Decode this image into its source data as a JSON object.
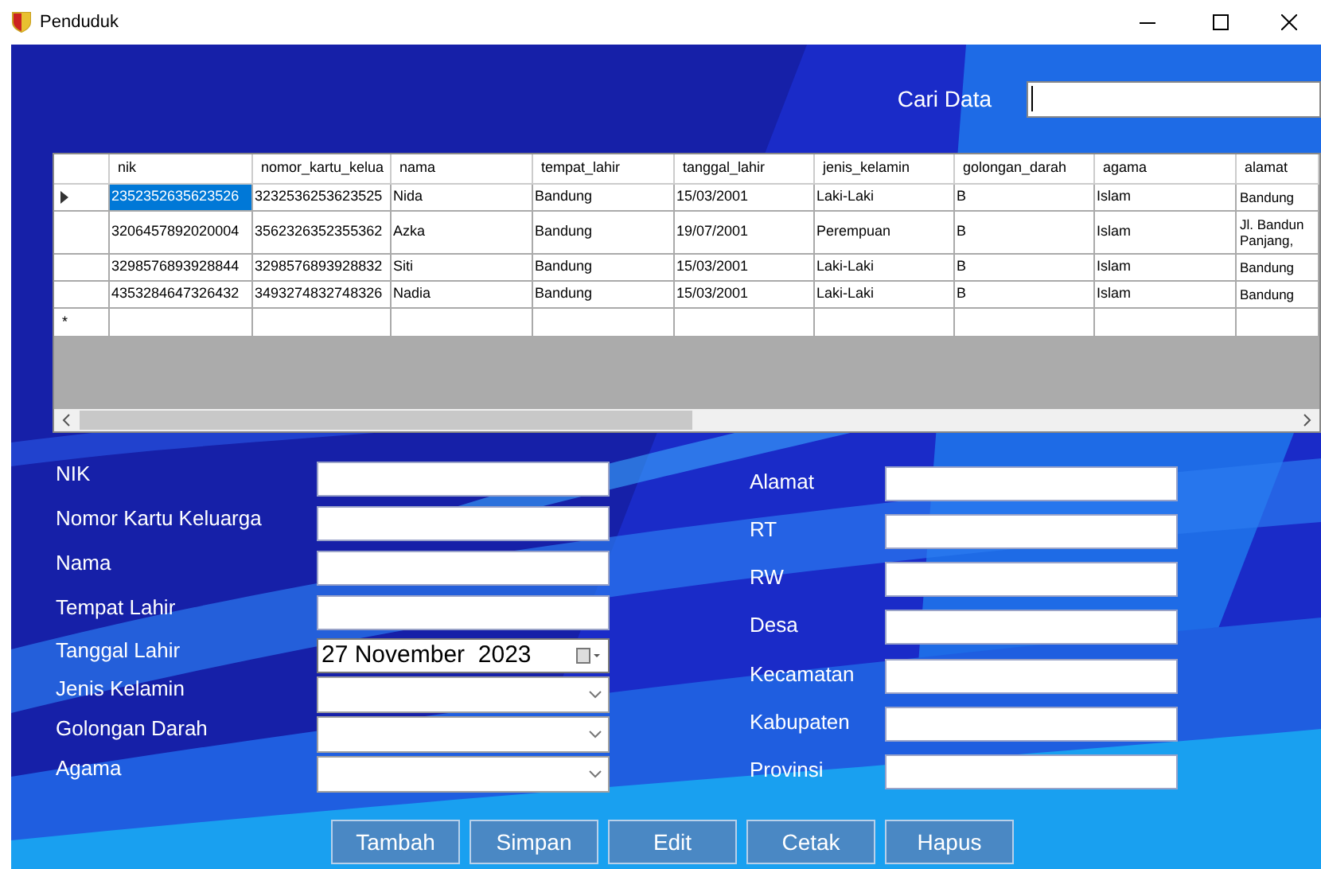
{
  "window": {
    "title": "Penduduk"
  },
  "search": {
    "label": "Cari Data"
  },
  "table": {
    "columns": [
      "nik",
      "nomor_kartu_kelua",
      "nama",
      "tempat_lahir",
      "tanggal_lahir",
      "jenis_kelamin",
      "golongan_darah",
      "agama",
      "alamat"
    ],
    "rows": [
      {
        "selected": true,
        "cells": [
          "2352352635623526",
          "3232536253623525",
          "Nida",
          "Bandung",
          "15/03/2001",
          "Laki-Laki",
          "B",
          "Islam",
          "Bandung"
        ]
      },
      {
        "selected": false,
        "cells": [
          "3206457892020004",
          "3562326352355362",
          "Azka",
          "Bandung",
          "19/07/2001",
          "Perempuan",
          "B",
          "Islam",
          "Jl. Bandun Panjang,"
        ]
      },
      {
        "selected": false,
        "cells": [
          "3298576893928844",
          "3298576893928832",
          "Siti",
          "Bandung",
          "15/03/2001",
          "Laki-Laki",
          "B",
          "Islam",
          "Bandung"
        ]
      },
      {
        "selected": false,
        "cells": [
          "4353284647326432",
          "3493274832748326",
          "Nadia",
          "Bandung",
          "15/03/2001",
          "Laki-Laki",
          "B",
          "Islam",
          "Bandung"
        ]
      }
    ],
    "new_row_marker": "*"
  },
  "form_left": [
    {
      "label": "NIK",
      "kind": "text"
    },
    {
      "label": "Nomor Kartu Keluarga",
      "kind": "text"
    },
    {
      "label": "Nama",
      "kind": "text"
    },
    {
      "label": "Tempat Lahir",
      "kind": "text"
    },
    {
      "label": "Tanggal Lahir",
      "kind": "date",
      "value": "27 November  2023"
    },
    {
      "label": "Jenis Kelamin",
      "kind": "combo"
    },
    {
      "label": "Golongan Darah",
      "kind": "combo"
    },
    {
      "label": "Agama",
      "kind": "combo"
    }
  ],
  "form_right": [
    {
      "label": "Alamat",
      "kind": "text"
    },
    {
      "label": "RT",
      "kind": "text"
    },
    {
      "label": "RW",
      "kind": "text"
    },
    {
      "label": "Desa",
      "kind": "text"
    },
    {
      "label": "Kecamatan",
      "kind": "text"
    },
    {
      "label": "Kabupaten",
      "kind": "text"
    },
    {
      "label": "Provinsi",
      "kind": "text"
    }
  ],
  "buttons": [
    "Tambah",
    "Simpan",
    "Edit",
    "Cetak",
    "Hapus"
  ]
}
